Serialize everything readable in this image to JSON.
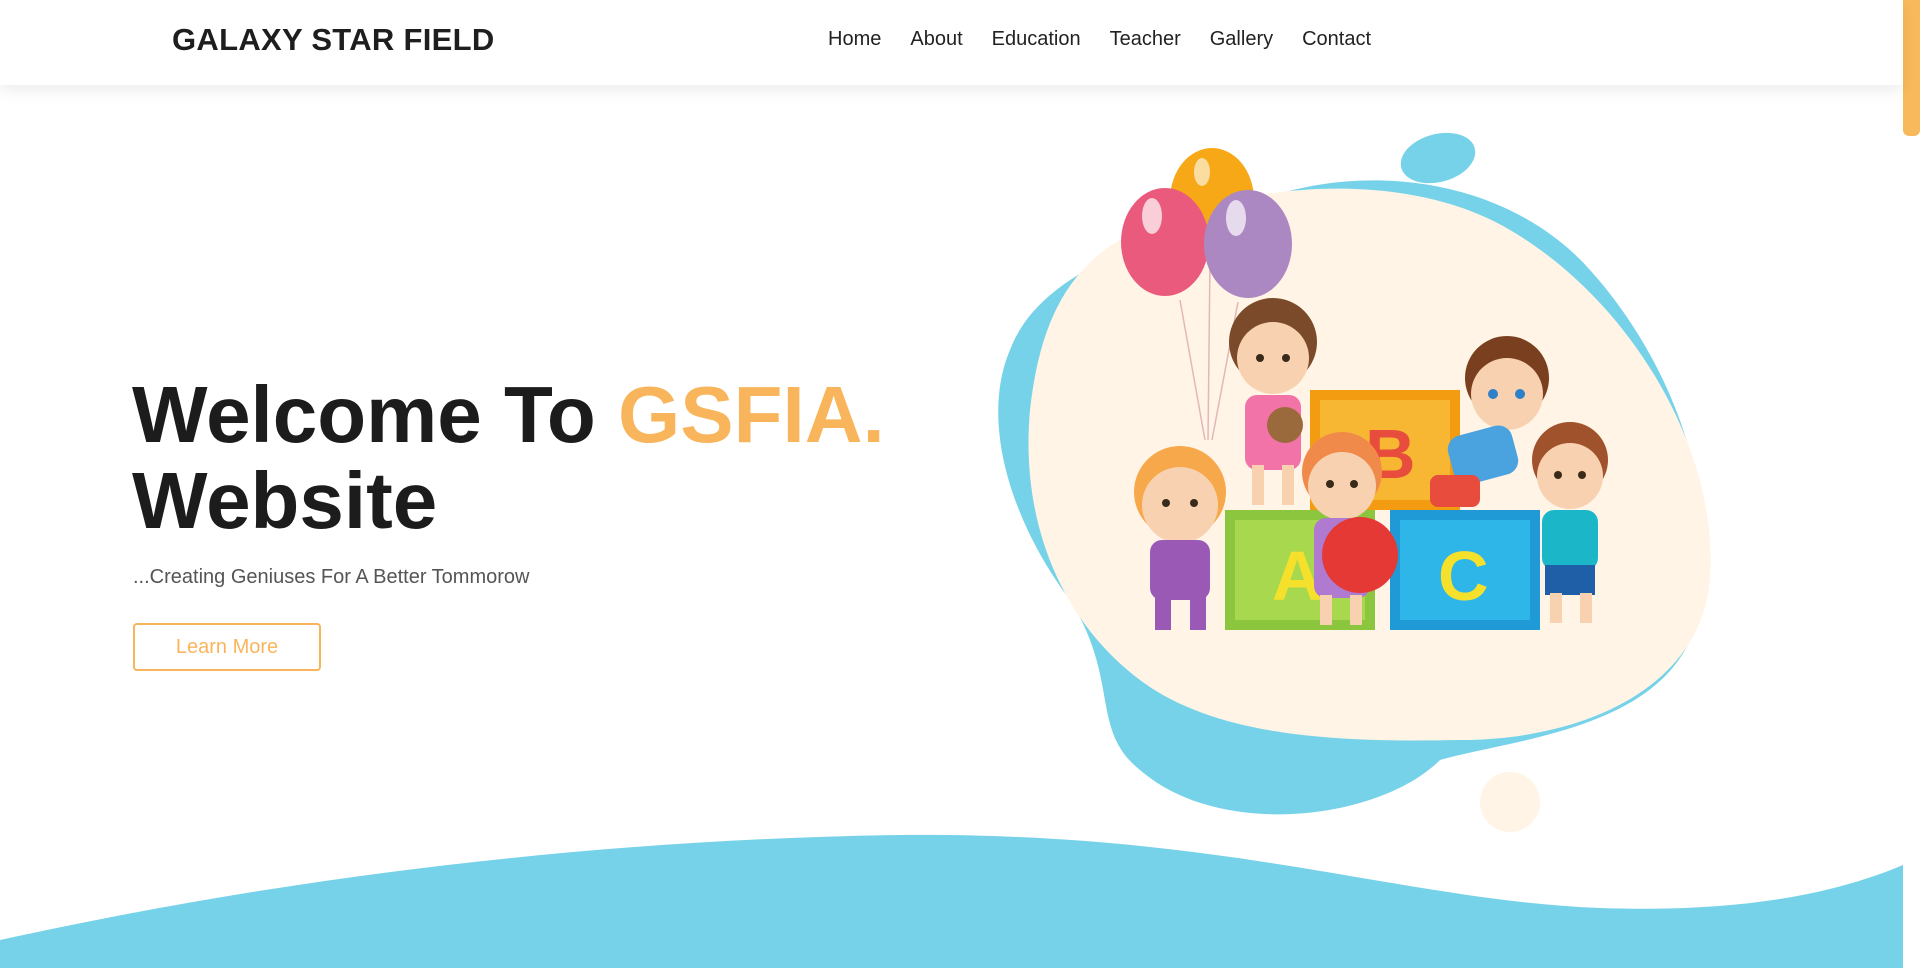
{
  "header": {
    "brand": "GALAXY STAR FIELD",
    "nav": [
      "Home",
      "About",
      "Education",
      "Teacher",
      "Gallery",
      "Contact"
    ]
  },
  "hero": {
    "title_line1": "Welcome To",
    "title_accent": "GSFIA.",
    "title_line2": "Website",
    "tagline": "...Creating Geniuses For A Better Tommorow",
    "cta_label": "Learn More"
  },
  "illustration": {
    "blocks": [
      "A",
      "B",
      "C"
    ]
  },
  "colors": {
    "accent": "#f8b55c",
    "blob_blue": "#76d2e8",
    "blob_cream": "#fff4e6",
    "text_dark": "#1c1c1c"
  },
  "icons": {
    "scrollbar": "scrollbar-thumb"
  }
}
